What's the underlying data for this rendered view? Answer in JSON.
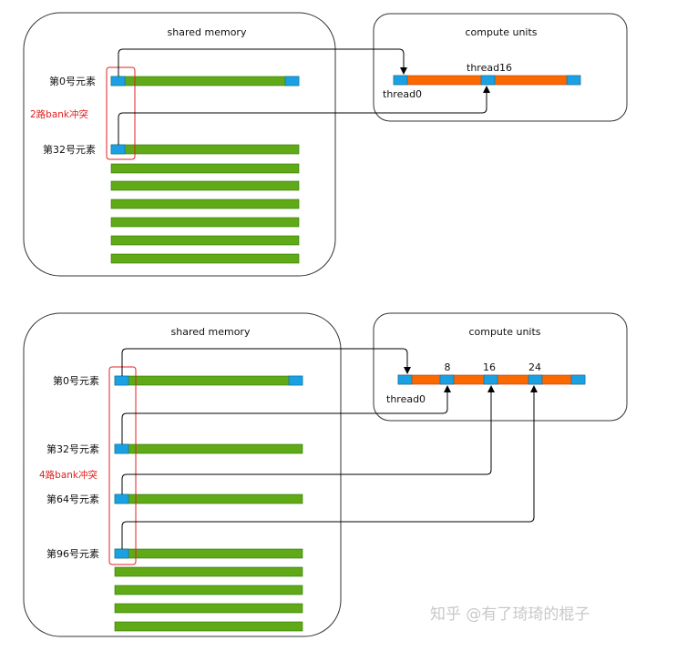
{
  "top": {
    "memory_title": "shared memory",
    "compute_title": "compute units",
    "row0_label": "第0号元素",
    "row32_label": "第32号元素",
    "conflict_label": "2路bank冲突",
    "thread0_label": "thread0",
    "thread16_label": "thread16"
  },
  "bottom": {
    "memory_title": "shared memory",
    "compute_title": "compute units",
    "row0_label": "第0号元素",
    "row32_label": "第32号元素",
    "row64_label": "第64号元素",
    "row96_label": "第96号元素",
    "conflict_label": "4路bank冲突",
    "thread0_label": "thread0",
    "tick8": "8",
    "tick16": "16",
    "tick24": "24"
  },
  "watermark": "知乎 @有了琦琦的棍子",
  "colors": {
    "bank_blue": "#1ba1e2",
    "bar_green": "#60a917",
    "thread_orange": "#fa6800",
    "conflict_red": "#e02020",
    "outline": "#333333"
  }
}
